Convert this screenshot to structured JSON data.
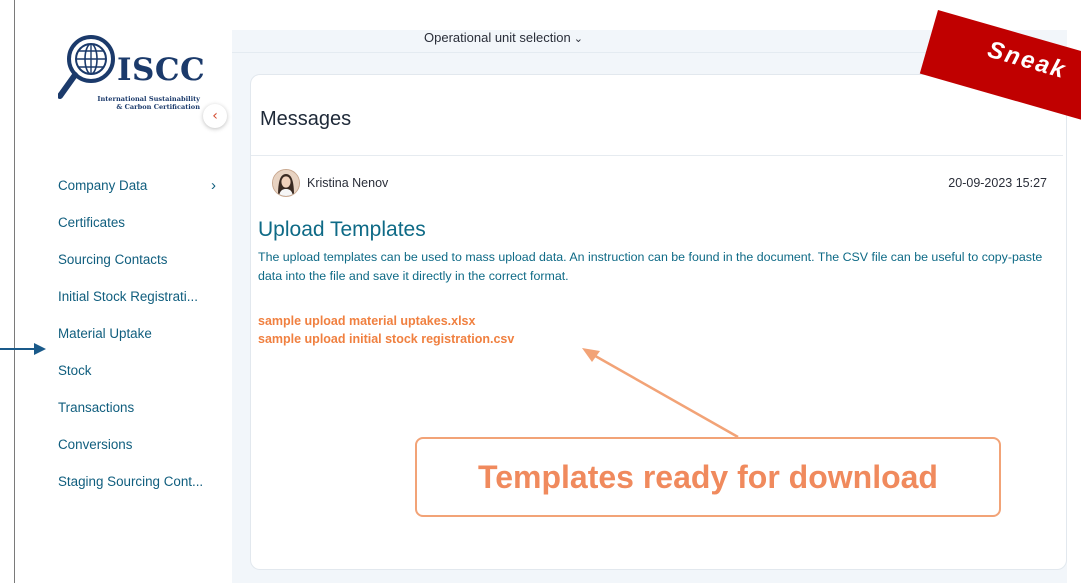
{
  "logo": {
    "name": "ISCC",
    "subtitle_line1": "International Sustainability",
    "subtitle_line2": "& Carbon Certification"
  },
  "sidebar": {
    "collapse_icon": "‹",
    "items": [
      {
        "label": "Company Data",
        "chevron": "›"
      },
      {
        "label": "Certificates"
      },
      {
        "label": "Sourcing Contacts"
      },
      {
        "label": "Initial Stock Registrati..."
      },
      {
        "label": "Material Uptake"
      },
      {
        "label": "Stock"
      },
      {
        "label": "Transactions"
      },
      {
        "label": "Conversions"
      },
      {
        "label": "Staging Sourcing Cont..."
      }
    ]
  },
  "header": {
    "operational_unit_label": "Operational unit selection",
    "chevron": "⌄"
  },
  "messages": {
    "title": "Messages",
    "author": "Kristina Nenov",
    "timestamp": "20-09-2023 15:27",
    "subject": "Upload Templates",
    "body": "The upload templates can be used to mass upload data. An instruction can be found in the document. The CSV file can be useful to copy-paste data into the file and save it directly in the correct format.",
    "attachments": [
      "sample upload material uptakes.xlsx",
      "sample upload initial stock registration.csv"
    ]
  },
  "callout": {
    "text": "Templates ready for download"
  },
  "banner": {
    "text": "Sneak"
  },
  "colors": {
    "nav_text": "#105e7e",
    "message_text": "#0e6a86",
    "attachment": "#f08040",
    "callout_border": "#f2a377",
    "banner_red": "#c00000"
  }
}
